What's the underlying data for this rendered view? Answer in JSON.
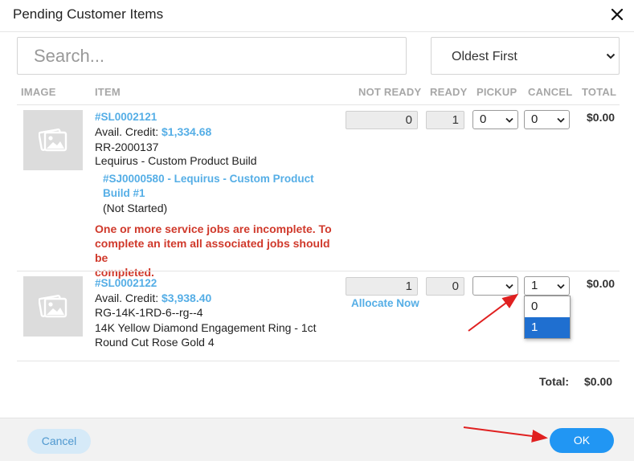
{
  "dialog": {
    "title": "Pending Customer Items"
  },
  "search": {
    "placeholder": "Search..."
  },
  "sort": {
    "selected": "Oldest First"
  },
  "columns": {
    "image": "IMAGE",
    "item": "ITEM",
    "not_ready": "NOT READY",
    "ready": "READY",
    "pickup": "PICKUP",
    "cancel": "CANCEL",
    "total": "TOTAL"
  },
  "items": [
    {
      "sku": "#SL0002121",
      "credit_label": "Avail. Credit:",
      "credit_value": "$1,334.68",
      "code": "RR-2000137",
      "name": "Lequirus - Custom Product Build",
      "job_link_line1": "#SJ0000580 - Lequirus - Custom Product",
      "job_link_line2": "Build #1",
      "job_status": "(Not Started)",
      "error_line1": "One or more service jobs are incomplete. To",
      "error_line2": "complete an item all associated jobs should be",
      "error_line3": "completed.",
      "not_ready": "0",
      "ready": "1",
      "pickup": "0",
      "cancel": "0",
      "total": "$0.00"
    },
    {
      "sku": "#SL0002122",
      "credit_label": "Avail. Credit:",
      "credit_value": "$3,938.40",
      "code": "RG-14K-1RD-6--rg--4",
      "name_line1": "14K Yellow Diamond Engagement Ring - 1ct",
      "name_line2": "Round Cut Rose Gold 4",
      "not_ready": "1",
      "ready": "0",
      "allocate_label": "Allocate Now",
      "pickup": "",
      "cancel": "1",
      "cancel_options": [
        "0",
        "1"
      ],
      "total": "$0.00"
    }
  ],
  "summary": {
    "total_label": "Total:",
    "total_value": "$0.00"
  },
  "footer": {
    "cancel_label": "Cancel",
    "ok_label": "OK"
  },
  "icons": {
    "close": "close-icon",
    "image_placeholder": "image-placeholder-icon",
    "chevron": "chevron-down-icon"
  },
  "colors": {
    "link": "#55aee6",
    "error": "#d0392b",
    "primary": "#2196f3",
    "annotation_arrow": "#e02020"
  }
}
